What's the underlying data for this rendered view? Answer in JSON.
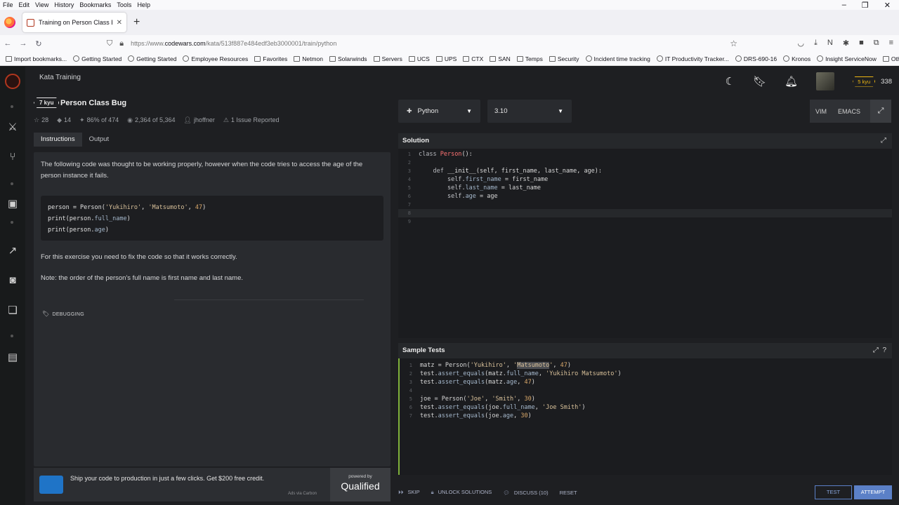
{
  "browser": {
    "menu": [
      "File",
      "Edit",
      "View",
      "History",
      "Bookmarks",
      "Tools",
      "Help"
    ],
    "tab_title": "Training on Person Class Bug | C",
    "url_prefix": "https://www.",
    "url_host": "codewars.com",
    "url_path": "/kata/513f887e484edf3eb3000001/train/python",
    "bookmarks": [
      "Import bookmarks...",
      "Getting Started",
      "Getting Started",
      "Employee Resources",
      "Favorites",
      "Netmon",
      "Solarwinds",
      "Servers",
      "UCS",
      "UPS",
      "CTX",
      "SAN",
      "Temps",
      "Security",
      "Incident time tracking",
      "IT Productivity Tracker...",
      "DRS-690-16",
      "Kronos",
      "Insight ServiceNow"
    ],
    "other_bookmarks": "Other Bookmarks"
  },
  "app": {
    "section": "Kata Training",
    "honor": "338",
    "user_rank": "5 kyu"
  },
  "kata": {
    "rank": "7 kyu",
    "title": "Person Class Bug",
    "stars": "28",
    "collections": "14",
    "satisfaction": "86% of 474",
    "completed": "2,364 of 5,364",
    "author": "jhoffner",
    "issues": "1 Issue Reported"
  },
  "tabs": {
    "instructions": "Instructions",
    "output": "Output"
  },
  "instructions": {
    "p1": "The following code was thought to be working properly, however when the code tries to access the age of the person instance it fails.",
    "p2": "For this exercise you need to fix the code so that it works correctly.",
    "p3": "Note: the order of the person's full name is first name and last name.",
    "tag": "DEBUGGING"
  },
  "ad": {
    "text": "Ship your code to production in just a few clicks. Get $200 free credit.",
    "via": "Ads via Carbon",
    "powered_by": "powered by",
    "sponsor": "Qualified"
  },
  "language": {
    "name": "Python",
    "version": "3.10"
  },
  "editor_modes": {
    "vim": "VIM",
    "emacs": "EMACS"
  },
  "solution": {
    "header": "Solution"
  },
  "tests": {
    "header": "Sample Tests"
  },
  "actions": {
    "skip": "SKIP",
    "unlock": "UNLOCK SOLUTIONS",
    "discuss": "DISCUSS (10)",
    "reset": "RESET",
    "test": "TEST",
    "attempt": "ATTEMPT"
  }
}
